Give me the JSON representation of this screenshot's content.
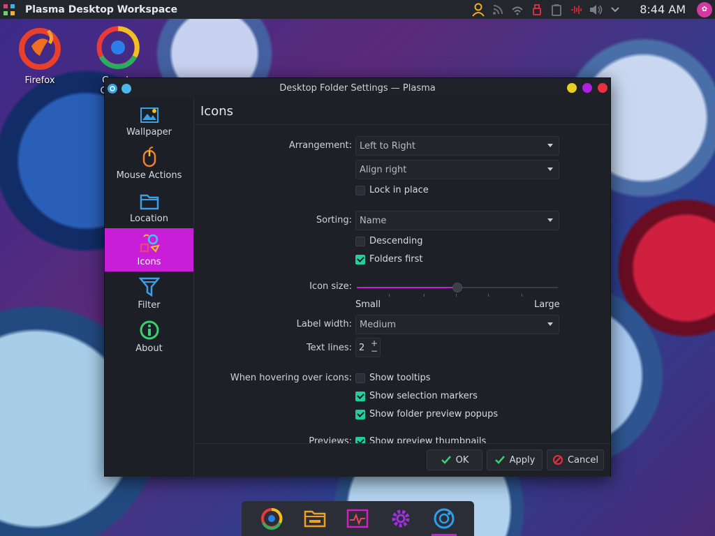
{
  "top_panel": {
    "app_title": "Plasma Desktop Workspace",
    "clock": "8:44 AM",
    "tray_icons": [
      "user-icon",
      "rss-icon",
      "network-icon",
      "usb-icon",
      "clipboard-icon",
      "audio-disabled-icon",
      "volume-icon",
      "expand-arrow-icon"
    ]
  },
  "desktop": {
    "icons": [
      {
        "label": "Firefox",
        "icon": "firefox-icon"
      },
      {
        "label": "Google Chrome",
        "icon": "chrome-icon"
      }
    ]
  },
  "window": {
    "title": "Desktop Folder Settings — Plasma",
    "sidebar": [
      {
        "label": "Wallpaper",
        "icon": "wallpaper-icon"
      },
      {
        "label": "Mouse Actions",
        "icon": "mouse-icon"
      },
      {
        "label": "Location",
        "icon": "folder-icon"
      },
      {
        "label": "Icons",
        "icon": "icons-icon",
        "active": true
      },
      {
        "label": "Filter",
        "icon": "filter-icon"
      },
      {
        "label": "About",
        "icon": "info-icon"
      }
    ],
    "page_title": "Icons",
    "form": {
      "arrangement_label": "Arrangement:",
      "arrangement_value": "Left to Right",
      "align_value": "Align right",
      "lock_label": "Lock in place",
      "lock_checked": false,
      "sorting_label": "Sorting:",
      "sorting_value": "Name",
      "descending_label": "Descending",
      "descending_checked": false,
      "folders_first_label": "Folders first",
      "folders_first_checked": true,
      "icon_size_label": "Icon size:",
      "icon_size_level": 0.5,
      "icon_size_min": "Small",
      "icon_size_max": "Large",
      "label_width_label": "Label width:",
      "label_width_value": "Medium",
      "text_lines_label": "Text lines:",
      "text_lines_value": "2",
      "hover_label": "When hovering over icons:",
      "tooltips_label": "Show tooltips",
      "tooltips_checked": false,
      "selection_markers_label": "Show selection markers",
      "selection_markers_checked": true,
      "folder_preview_label": "Show folder preview popups",
      "folder_preview_checked": true,
      "previews_label": "Previews:",
      "thumbnails_label": "Show preview thumbnails",
      "thumbnails_checked": true
    },
    "buttons": {
      "ok": "OK",
      "apply": "Apply",
      "cancel": "Cancel"
    }
  },
  "dock": {
    "items": [
      "chrome-icon",
      "files-icon",
      "system-monitor-icon",
      "settings-icon",
      "plasma-settings-icon"
    ]
  },
  "colors": {
    "accent": "#c81ed8",
    "check": "#1fcf9f",
    "window_bg": "#1e2028"
  }
}
